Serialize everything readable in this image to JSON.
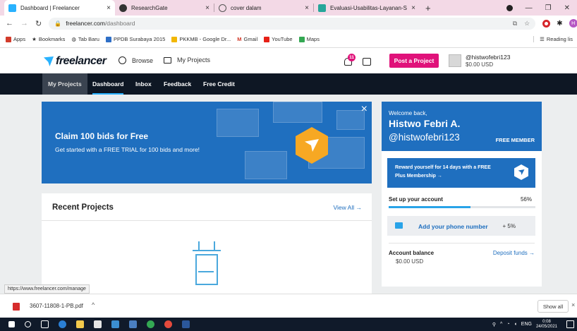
{
  "browser": {
    "tabs": [
      {
        "title": "Dashboard | Freelancer",
        "icon": "freelancer-favicon",
        "active": true
      },
      {
        "title": "ResearchGate",
        "icon": "researchgate-favicon",
        "active": false
      },
      {
        "title": "cover dalam",
        "icon": "search-favicon",
        "active": false
      },
      {
        "title": "Evaluasi-Usabilitas-Layanan-Sist",
        "icon": "doc-favicon",
        "active": false
      }
    ],
    "new_tab": "+",
    "close": "×",
    "url_host": "freelancer.com",
    "url_path": "/dashboard",
    "bookmarks": [
      {
        "label": "Apps",
        "icon": "apps-grid-icon",
        "color": "#d23b2b"
      },
      {
        "label": "Bookmarks",
        "icon": "star-icon",
        "color": "#222222"
      },
      {
        "label": "Tab Baru",
        "icon": "globe-icon",
        "color": "#333333"
      },
      {
        "label": "PPDB Surabaya 2015",
        "icon": "ppdb-icon",
        "color": "#2e6fc7"
      },
      {
        "label": "PKKMB - Google Dr...",
        "icon": "drive-icon",
        "color": "#f2b705"
      },
      {
        "label": "Gmail",
        "icon": "gmail-icon",
        "color": "#d23b2b"
      },
      {
        "label": "YouTube",
        "icon": "youtube-icon",
        "color": "#e62117"
      },
      {
        "label": "Maps",
        "icon": "maps-icon",
        "color": "#34a853"
      }
    ],
    "reading_list": "Reading lis",
    "profile_initial": "H",
    "status_url": "https://www.freelancer.com/manage"
  },
  "header": {
    "logo_text": "freelancer",
    "browse": "Browse",
    "my_projects": "My Projects",
    "notification_count": "11",
    "post_project": "Post a Project",
    "username": "@histwofebri123",
    "balance": "$0.00 USD"
  },
  "subnav": {
    "items": [
      "My Projects",
      "Dashboard",
      "Inbox",
      "Feedback",
      "Free Credit"
    ]
  },
  "banner": {
    "title": "Claim 100 bids for Free",
    "subtitle": "Get started with a FREE TRIAL for 100 bids and more!",
    "close": "×"
  },
  "recent_projects": {
    "title": "Recent Projects",
    "view_all": "View All →"
  },
  "profile_card": {
    "welcome": "Welcome back,",
    "name": "Histwo Febri A.",
    "handle": "@histwofebri123",
    "membership": "FREE MEMBER",
    "promo_line1": "Reward yourself for 14 days with a FREE",
    "promo_line2": "Plus Membership →",
    "setup_label": "Set up your account",
    "setup_percent": "56%",
    "setup_progress": 0.56,
    "phone_task": "Add your phone number",
    "phone_bonus": "+ 5%",
    "account_balance_label": "Account balance",
    "account_balance_value": "$0.00 USD",
    "deposit_funds": "Deposit funds →"
  },
  "downloads": {
    "file": "3607-11808-1-PB.pdf",
    "chevron": "^",
    "show_all": "Show all",
    "close": "×"
  },
  "taskbar": {
    "lang": "ENG",
    "time": "0:08",
    "date": "24/05/2021"
  },
  "colors": {
    "brand_blue": "#1f6fbf",
    "pink": "#e0127a",
    "navy": "#0e1724",
    "light_blue": "#29b2fe",
    "orange": "#f7a823"
  }
}
